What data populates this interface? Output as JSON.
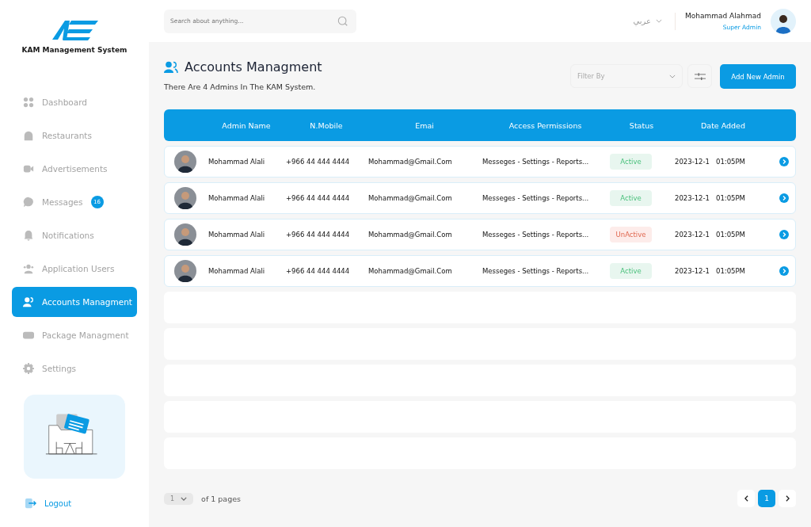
{
  "brand": {
    "name": "KAM Management System"
  },
  "sidebar": {
    "items": [
      {
        "label": "Dashboard",
        "selected": false
      },
      {
        "label": "Restaurants",
        "selected": false
      },
      {
        "label": "Advertisements",
        "selected": false
      },
      {
        "label": "Messages",
        "selected": false,
        "badge": "16"
      },
      {
        "label": "Notifications",
        "selected": false
      },
      {
        "label": "Application Users",
        "selected": false
      },
      {
        "label": "Accounts Managment",
        "selected": true
      },
      {
        "label": "Package Managment",
        "selected": false
      },
      {
        "label": "Settings",
        "selected": false
      }
    ],
    "logout": "Logout"
  },
  "topbar": {
    "search_placeholder": "Search about anything...",
    "language": "عربي",
    "user_name": "Mohammad Alahmad",
    "user_role": "Super Admin"
  },
  "page": {
    "title": "Accounts Managment",
    "subtitle": "There Are 4 Admins In The KAM System.",
    "filter_placeholder": "Filter By",
    "add_button": "Add New Admin"
  },
  "table": {
    "columns": [
      "Admin Name",
      "N.Mobile",
      "Emai",
      "Access Permissions",
      "Status",
      "Date Added"
    ],
    "rows": [
      {
        "name": "Mohammad Alali",
        "mobile": "+966 44 444 4444",
        "email": "Mohammad@Gmail.Com",
        "permissions": "Messeges - Settings - Reports...",
        "status": "Active",
        "active": true,
        "date": "2023-12-1",
        "time": "01:05PM"
      },
      {
        "name": "Mohammad Alali",
        "mobile": "+966 44 444 4444",
        "email": "Mohammad@Gmail.Com",
        "permissions": "Messeges - Settings - Reports...",
        "status": "Active",
        "active": true,
        "date": "2023-12-1",
        "time": "01:05PM"
      },
      {
        "name": "Mohammad Alali",
        "mobile": "+966 44 444 4444",
        "email": "Mohammad@Gmail.Com",
        "permissions": "Messeges - Settings - Reports...",
        "status": "UnActive",
        "active": false,
        "date": "2023-12-1",
        "time": "01:05PM"
      },
      {
        "name": "Mohammad Alali",
        "mobile": "+966 44 444 4444",
        "email": "Mohammad@Gmail.Com",
        "permissions": "Messeges - Settings - Reports...",
        "status": "Active",
        "active": true,
        "date": "2023-12-1",
        "time": "01:05PM"
      }
    ]
  },
  "pagination": {
    "page_select": "1",
    "total": "of 1 pages",
    "pages": [
      {
        "label": "1",
        "selected": true
      }
    ]
  }
}
